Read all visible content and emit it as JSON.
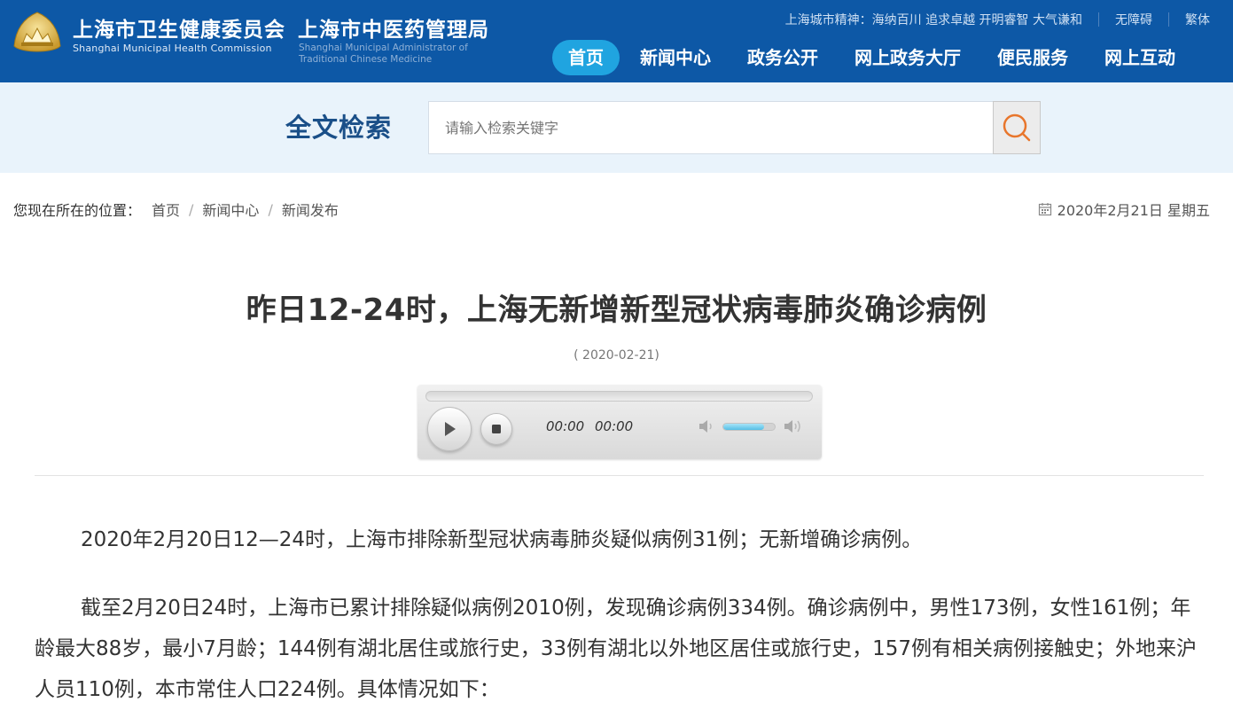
{
  "header": {
    "org_cn": "上海市卫生健康委员会",
    "org_en": "Shanghai Municipal Health Commission",
    "org2_cn": "上海市中医药管理局",
    "org2_en": "Shanghai Municipal Administrator of Traditional Chinese Medicine",
    "slogan": "上海城市精神：海纳百川 追求卓越 开明睿智 大气谦和",
    "accessibility": "无障碍",
    "traditional": "繁体",
    "nav": [
      "首页",
      "新闻中心",
      "政务公开",
      "网上政务大厅",
      "便民服务",
      "网上互动"
    ],
    "nav_active_index": 0
  },
  "search": {
    "title": "全文检索",
    "placeholder": "请输入检索关键字",
    "icon": "search-icon"
  },
  "breadcrumb": {
    "label": "您现在所在的位置：",
    "items": [
      "首页",
      "新闻中心",
      "新闻发布"
    ]
  },
  "date_display": "2020年2月21日 星期五",
  "article": {
    "title": "昨日12-24时，上海无新增新型冠状病毒肺炎确诊病例",
    "date": "( 2020-02-21)",
    "paragraphs": [
      "2020年2月20日12—24时，上海市排除新型冠状病毒肺炎疑似病例31例；无新增确诊病例。",
      "截至2月20日24时，上海市已累计排除疑似病例2010例，发现确诊病例334例。确诊病例中，男性173例，女性161例；年龄最大88岁，最小7月龄；144例有湖北居住或旅行史，33例有湖北以外地区居住或旅行史，157例有相关病例接触史；外地来沪人员110例，本市常住人口224例。具体情况如下："
    ]
  },
  "player": {
    "current_time": "00:00",
    "duration": "00:00",
    "progress": 0,
    "volume": 0.8
  },
  "colors": {
    "header_bg": "#0d58a6",
    "nav_active": "#20a4e0",
    "search_band": "#e9f3fb",
    "search_title": "#1a4f88",
    "search_icon": "#e8762c"
  }
}
